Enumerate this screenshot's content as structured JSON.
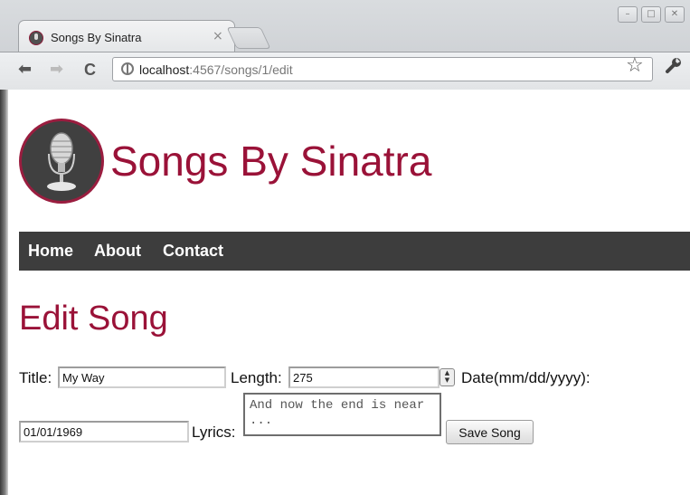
{
  "browser": {
    "tab_title": "Songs By Sinatra",
    "tab_close": "×",
    "url_host": "localhost",
    "url_path": ":4567/songs/1/edit",
    "back_glyph": "⬅",
    "forward_glyph": "➡",
    "reload_glyph": "C",
    "star_glyph": "☆",
    "wrench_glyph": "🔧",
    "window_controls": [
      "–",
      "□",
      "✕"
    ]
  },
  "site": {
    "title": "Songs By Sinatra",
    "accent_color": "#9a1238"
  },
  "nav": {
    "items": [
      "Home",
      "About",
      "Contact"
    ]
  },
  "form": {
    "heading": "Edit Song",
    "title_label": "Title:",
    "title_value": "My Way",
    "length_label": "Length:",
    "length_value": "275",
    "date_label": "Date(mm/dd/yyyy):",
    "date_value": "01/01/1969",
    "lyrics_label": "Lyrics:",
    "lyrics_value": "And now the end is near ...",
    "save_label": "Save Song"
  },
  "icons": {
    "favicon": "microphone-icon",
    "logo": "microphone-icon",
    "address": "globe-icon"
  }
}
